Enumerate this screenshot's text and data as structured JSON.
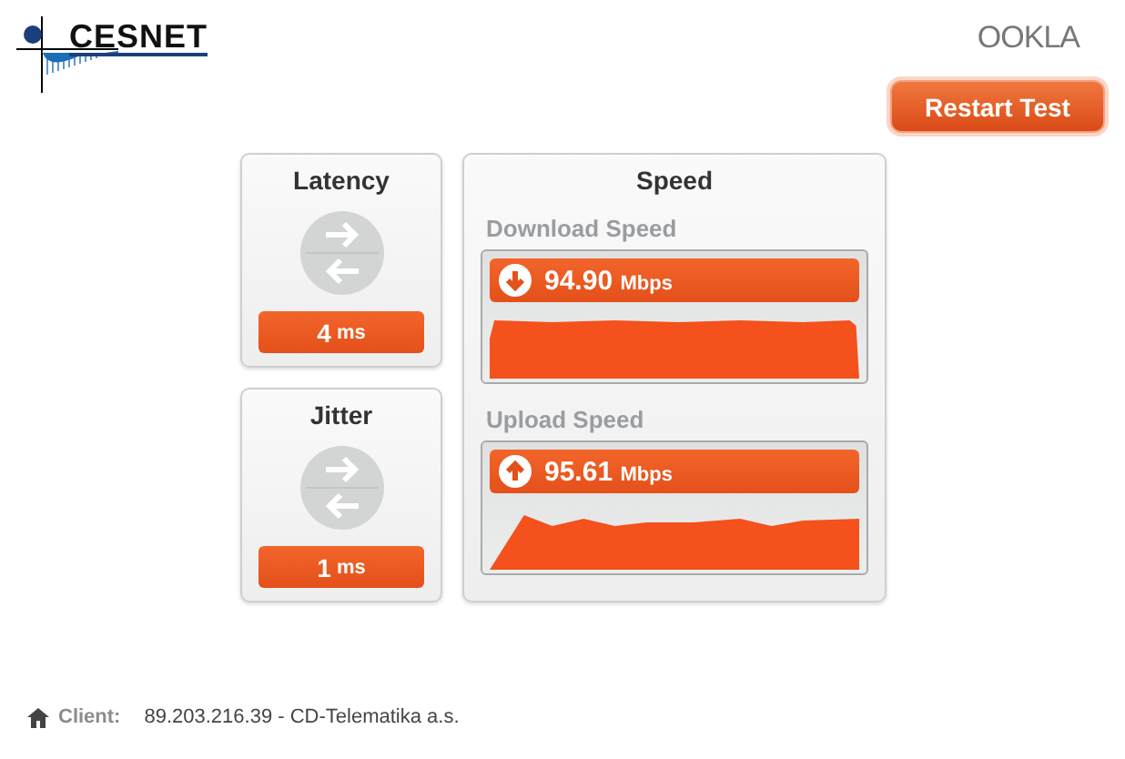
{
  "header": {
    "logo": "CESNET",
    "brand": "OOKLA",
    "restart_button": "Restart Test"
  },
  "metrics": [
    {
      "title": "Latency",
      "value": "4",
      "unit": "ms"
    },
    {
      "title": "Jitter",
      "value": "1",
      "unit": "ms"
    }
  ],
  "speed": {
    "title": "Speed",
    "tests": [
      {
        "kind": "download",
        "label": "Download Speed",
        "value": "94.90",
        "unit": "Mbps"
      },
      {
        "kind": "upload",
        "label": "Upload Speed",
        "value": "95.61",
        "unit": "Mbps"
      }
    ]
  },
  "client": {
    "label": "Client:",
    "value": "89.203.216.39 - CD-Telematika a.s."
  }
}
